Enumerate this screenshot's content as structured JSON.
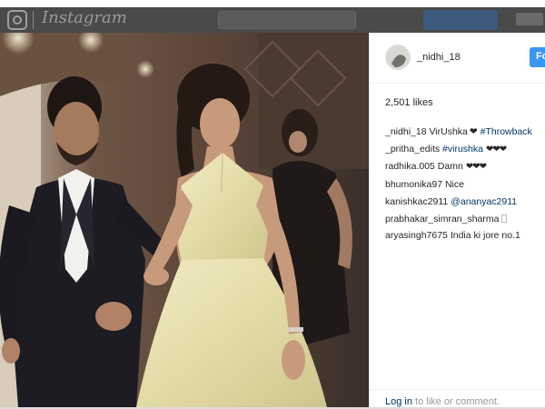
{
  "header": {
    "brand": "Instagram"
  },
  "post": {
    "username": "_nidhi_18",
    "follow_label": "Follow",
    "likes": "2,501 likes",
    "comments": [
      {
        "user": "_nidhi_18",
        "text": "VirUshka",
        "heart": "❤",
        "link": "#Throwback"
      },
      {
        "user": "_pritha_edits",
        "link": "#virushka",
        "hearts": "❤❤❤"
      },
      {
        "user": "radhika.005",
        "text": "Damn",
        "hearts": "❤❤❤"
      },
      {
        "user": "bhumonika97",
        "text": "Nice"
      },
      {
        "user": "kanishkac2911",
        "link": "@ananyac2911"
      },
      {
        "user": "prabhakar_simran_sharma"
      },
      {
        "user": "aryasingh7675",
        "text": "India ki jore no.1"
      }
    ],
    "login_prompt": {
      "link": "Log in",
      "rest": "to like or comment."
    }
  },
  "colors": {
    "link": "#003569",
    "follow_button": "#3897f0",
    "header_bg": "#4a4a4a"
  }
}
